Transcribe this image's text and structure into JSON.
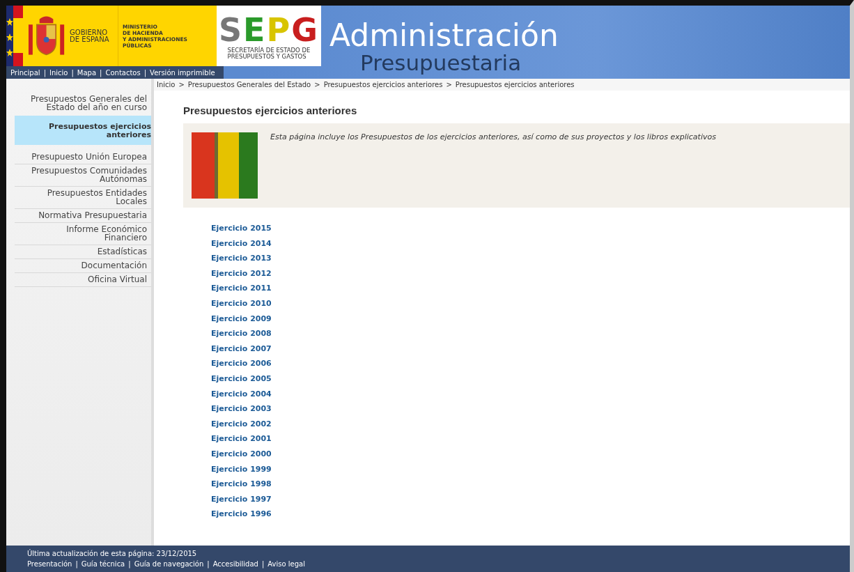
{
  "header": {
    "gov_line1": "GOBIERNO",
    "gov_line2": "DE ESPAÑA",
    "ministry_lines": [
      "MINISTERIO",
      "DE HACIENDA",
      "Y ADMINISTRACIONES PÚBLICAS"
    ],
    "logo_letters": "SEPG",
    "logo_caption_lines": [
      "SECRETARÍA DE ESTADO DE",
      "PRESUPUESTOS Y GASTOS"
    ],
    "title": "Administración",
    "subtitle": "Presupuestaria"
  },
  "top_nav": {
    "separator": "|",
    "links": [
      "Principal",
      "Inicio",
      "Mapa",
      "Contactos",
      "Versión imprimible"
    ]
  },
  "sidebar": {
    "items": [
      {
        "label": "Presupuestos Generales del Estado del año en curso",
        "selected": false
      },
      {
        "label": "Presupuestos ejercicios anteriores",
        "selected": true
      },
      {
        "label": "Presupuesto Unión Europea",
        "selected": false
      },
      {
        "label": "Presupuestos Comunidades Autónomas",
        "selected": false
      },
      {
        "label": "Presupuestos Entidades Locales",
        "selected": false
      },
      {
        "label": "Normativa Presupuestaria",
        "selected": false
      },
      {
        "label": "Informe Económico Financiero",
        "selected": false
      },
      {
        "label": "Estadísticas",
        "selected": false
      },
      {
        "label": "Documentación",
        "selected": false
      },
      {
        "label": "Oficina Virtual",
        "selected": false
      }
    ]
  },
  "breadcrumb": {
    "separator": ">",
    "items": [
      "Inicio",
      "Presupuestos Generales del Estado",
      "Presupuestos ejercicios anteriores",
      "Presupuestos ejercicios anteriores"
    ]
  },
  "page_title": "Presupuestos ejercicios anteriores",
  "intro": "Esta página incluye los Presupuestos de los ejercicios anteriores, así como de sus proyectos y los libros explicativos",
  "year_links": [
    "Ejercicio 2015",
    "Ejercicio 2014",
    "Ejercicio 2013",
    "Ejercicio 2012",
    "Ejercicio 2011",
    "Ejercicio 2010",
    "Ejercicio 2009",
    "Ejercicio 2008",
    "Ejercicio 2007",
    "Ejercicio 2006",
    "Ejercicio 2005",
    "Ejercicio 2004",
    "Ejercicio 2003",
    "Ejercicio 2002",
    "Ejercicio 2001",
    "Ejercicio 2000",
    "Ejercicio 1999",
    "Ejercicio 1998",
    "Ejercicio 1997",
    "Ejercicio 1996"
  ],
  "footer": {
    "updated": "Última actualización de esta página: 23/12/2015",
    "separator": "|",
    "links": [
      "Presentación",
      "Guía técnica",
      "Guía de navegación",
      "Accesibilidad",
      "Aviso legal"
    ]
  }
}
